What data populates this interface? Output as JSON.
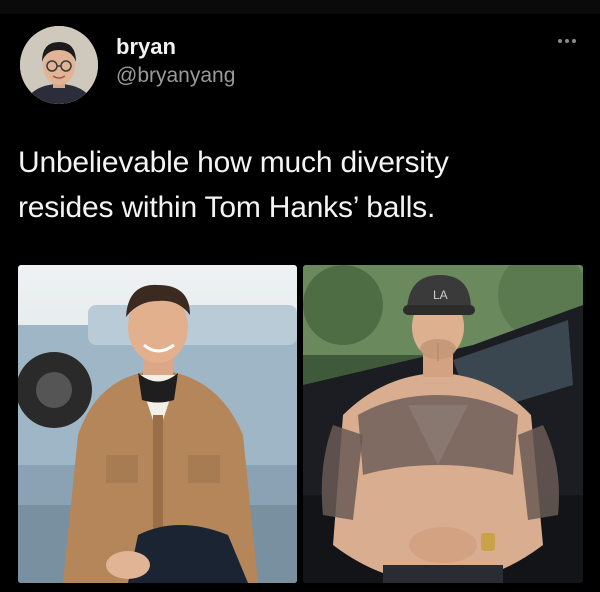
{
  "author": {
    "display_name": "bryan",
    "handle": "@bryanyang",
    "avatar_icon": "avatar-photo"
  },
  "menu": {
    "icon": "more-options-icon"
  },
  "tweet": {
    "text_line1": "Unbelievable how much diversity",
    "text_line2": "resides within Tom Hanks’ balls."
  },
  "media": [
    {
      "name": "photo-man-in-tan-jacket"
    },
    {
      "name": "photo-tattooed-man-with-cap"
    }
  ],
  "colors": {
    "background": "#000000",
    "text": "#f4f4f4",
    "secondary_text": "#9a9a9a"
  }
}
